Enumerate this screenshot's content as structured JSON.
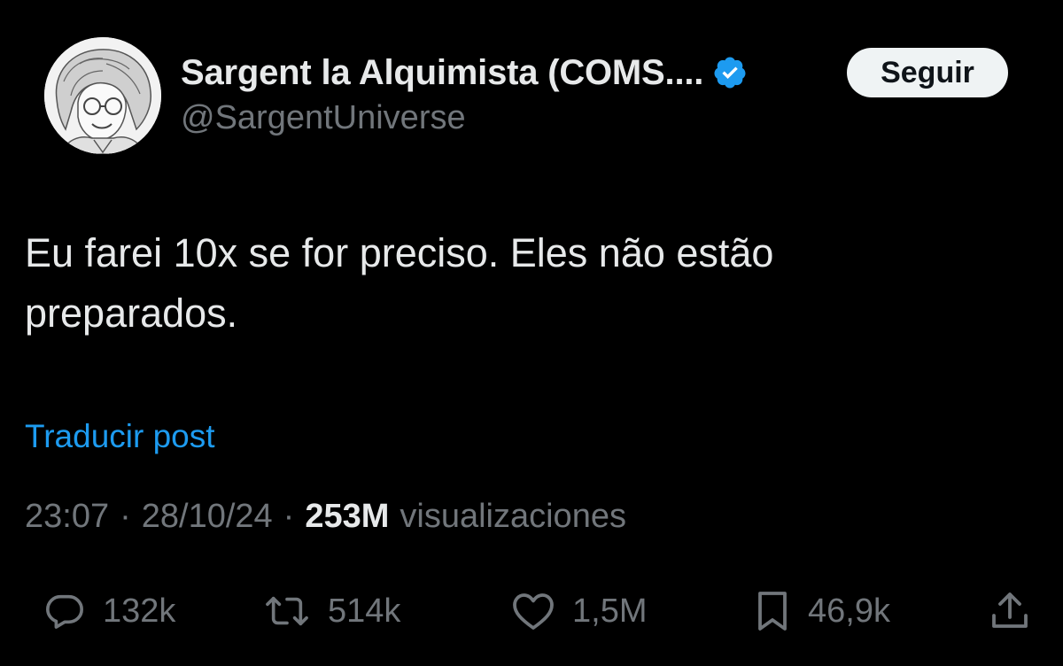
{
  "author": {
    "display_name": "Sargent la Alquimista (COMS....",
    "handle": "@SargentUniverse",
    "verified_icon": "verified-badge-icon",
    "avatar_icon": "avatar-image"
  },
  "follow_button": {
    "label": "Seguir"
  },
  "tweet": {
    "text_line1": "Eu farei 10x se for preciso. Eles não estão",
    "text_line2": "preparados.",
    "translate_label": "Traducir post"
  },
  "meta": {
    "time": "23:07",
    "separator": "·",
    "date": "28/10/24",
    "views_count": "253M",
    "views_label": "visualizaciones"
  },
  "actions": {
    "reply": {
      "icon": "reply-icon",
      "count": "132k"
    },
    "repost": {
      "icon": "repost-icon",
      "count": "514k"
    },
    "like": {
      "icon": "heart-icon",
      "count": "1,5M"
    },
    "bookmark": {
      "icon": "bookmark-icon",
      "count": "46,9k"
    },
    "share": {
      "icon": "share-icon"
    }
  },
  "colors": {
    "background": "#000000",
    "text": "#e7e9ea",
    "secondary": "#71767b",
    "link": "#1d9bf0",
    "verified": "#1d9bf0",
    "button_bg": "#eff3f4"
  }
}
